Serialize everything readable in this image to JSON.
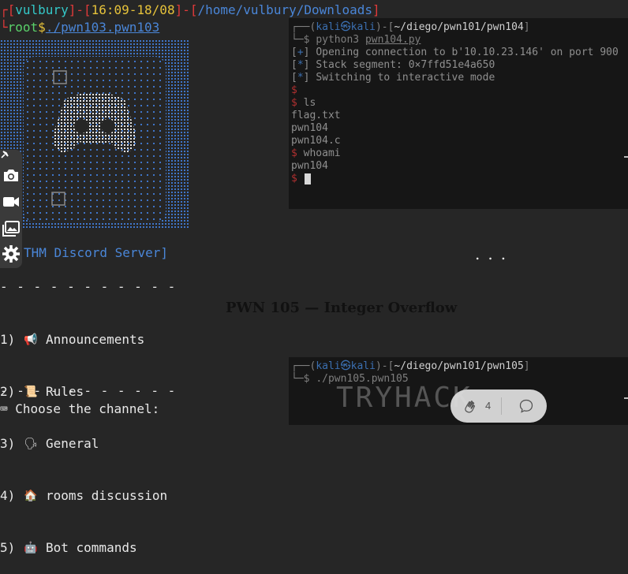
{
  "prompt": {
    "line1": {
      "bracket_open": "┌[",
      "user": "vulbury",
      "sep1": "]-[",
      "time": "16:09-18/08",
      "sep2": "]-[",
      "path": "/home/vulbury/Downloads",
      "bracket_close": "]"
    },
    "line2": {
      "corner": "└",
      "user": "root",
      "dollar": "$",
      "command": "./pwn103.pwn103"
    }
  },
  "discord_server_label": "THM Discord Server]",
  "divider": "- - - - - - - - - - -",
  "menu": [
    {
      "num": "1)",
      "icon": "megaphone-icon",
      "glyph": "📢",
      "label": "Announcements"
    },
    {
      "num": "2)",
      "icon": "scroll-icon",
      "glyph": "📜",
      "label": "Rules"
    },
    {
      "num": "3)",
      "icon": "speaking-head-icon",
      "glyph": "🗣",
      "label": "General"
    },
    {
      "num": "4)",
      "icon": "house-icon",
      "glyph": "🏠",
      "label": "rooms discussion"
    },
    {
      "num": "5)",
      "icon": "robot-icon",
      "glyph": "🤖",
      "label": "Bot commands"
    }
  ],
  "choose_prompt": "⌨ Choose the channel:",
  "term1": {
    "header_prefix": "┌──(",
    "host": "kali㉿kali",
    "header_mid": ")-[",
    "path": "~/diego/pwn101/pwn104",
    "header_end": "]",
    "prompt_prefix": "└─$",
    "command": "python3",
    "command_arg": "pwn104.py",
    "log": [
      {
        "tag": "+",
        "text": "Opening connection to b'10.10.23.146' on port 900"
      },
      {
        "tag": "*",
        "text": "Stack segment: 0×7ffd51e4a650"
      },
      {
        "tag": "*",
        "text": "Switching to interactive mode"
      }
    ],
    "shell_dollar": "$",
    "session": [
      {
        "kind": "cmd",
        "text": "ls"
      },
      {
        "kind": "out",
        "text": "flag.txt"
      },
      {
        "kind": "out",
        "text": "pwn104"
      },
      {
        "kind": "out",
        "text": "pwn104.c"
      },
      {
        "kind": "cmd",
        "text": "whoami"
      },
      {
        "kind": "out",
        "text": "pwn104"
      }
    ]
  },
  "ellipsis": "...",
  "section_title": "PWN 105 — Integer Overflow",
  "term2": {
    "path": "~/diego/pwn101/pwn105",
    "command": "./pwn105.pwn105",
    "banner": "TRYHACK"
  },
  "reactions": {
    "clap_count": "4"
  },
  "colors": {
    "red": "#e03a3a",
    "cyan": "#34c8c8",
    "yellow": "#e6c23a",
    "blue": "#4a86d8",
    "terminal_bg": "#161616"
  }
}
